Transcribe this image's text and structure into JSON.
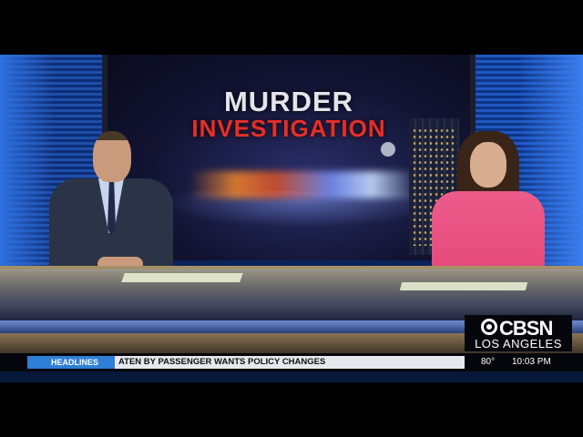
{
  "screen": {
    "headline_line1": "MURDER",
    "headline_line2": "INVESTIGATION"
  },
  "logo": {
    "network": "CBSN",
    "city": "LOS ANGELES"
  },
  "ticker": {
    "label": "HEADLINES",
    "text": "ATEN BY PASSENGER WANTS POLICY CHANGES",
    "temperature": "80°",
    "time": "10:03 PM"
  },
  "colors": {
    "ticker_label_bg": "#2f7fd6",
    "headline_red": "#e4302a",
    "anchor_dress": "#e4487a"
  }
}
